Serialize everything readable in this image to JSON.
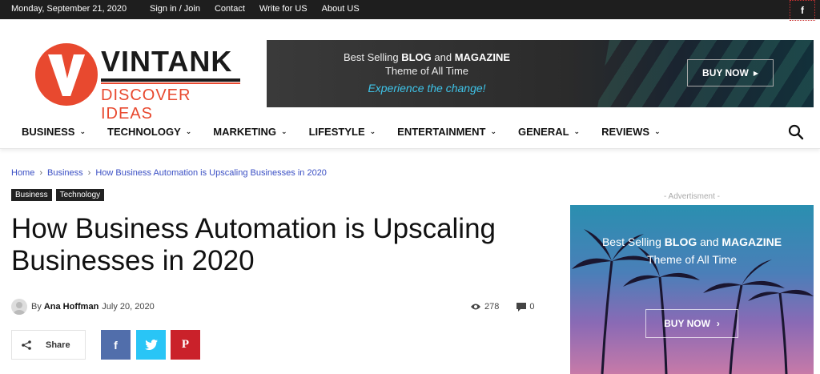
{
  "topbar": {
    "date": "Monday, September 21, 2020",
    "links": [
      "Sign in / Join",
      "Contact",
      "Write for US",
      "About US"
    ],
    "facebook_glyph": "f"
  },
  "logo": {
    "wordmark": "VINTANK",
    "tagline": "DISCOVER IDEAS",
    "brand_color": "#e8492f"
  },
  "banner": {
    "line1_pre": "Best Selling ",
    "line1_b1": "BLOG",
    "line1_mid": " and ",
    "line1_b2": "MAGAZINE",
    "line2": "Theme of All Time",
    "line3": "Experience the change!",
    "button": "BUY NOW"
  },
  "nav": {
    "items": [
      "BUSINESS",
      "TECHNOLOGY",
      "MARKETING",
      "LIFESTYLE",
      "ENTERTAINMENT",
      "GENERAL",
      "REVIEWS"
    ]
  },
  "breadcrumb": {
    "items": [
      "Home",
      "Business",
      "How Business Automation is Upscaling Businesses in 2020"
    ],
    "separator": "›"
  },
  "categories": [
    "Business",
    "Technology"
  ],
  "article": {
    "title_line1": "How Business Automation is Upscaling",
    "title_line2": "Businesses in 2020",
    "by": "By",
    "author": "Ana Hoffman",
    "date": "July 20, 2020",
    "views": "278",
    "comments": "0"
  },
  "share": {
    "label": "Share",
    "facebook_glyph": "f",
    "pinterest_glyph": "P"
  },
  "sidebar": {
    "ad_label": "- Advertisment -",
    "ad_line1_pre": "Best Selling ",
    "ad_line1_b1": "BLOG",
    "ad_line1_mid": " and ",
    "ad_line1_b2": "MAGAZINE",
    "ad_line2": "Theme of All Time",
    "ad_button": "BUY NOW"
  }
}
